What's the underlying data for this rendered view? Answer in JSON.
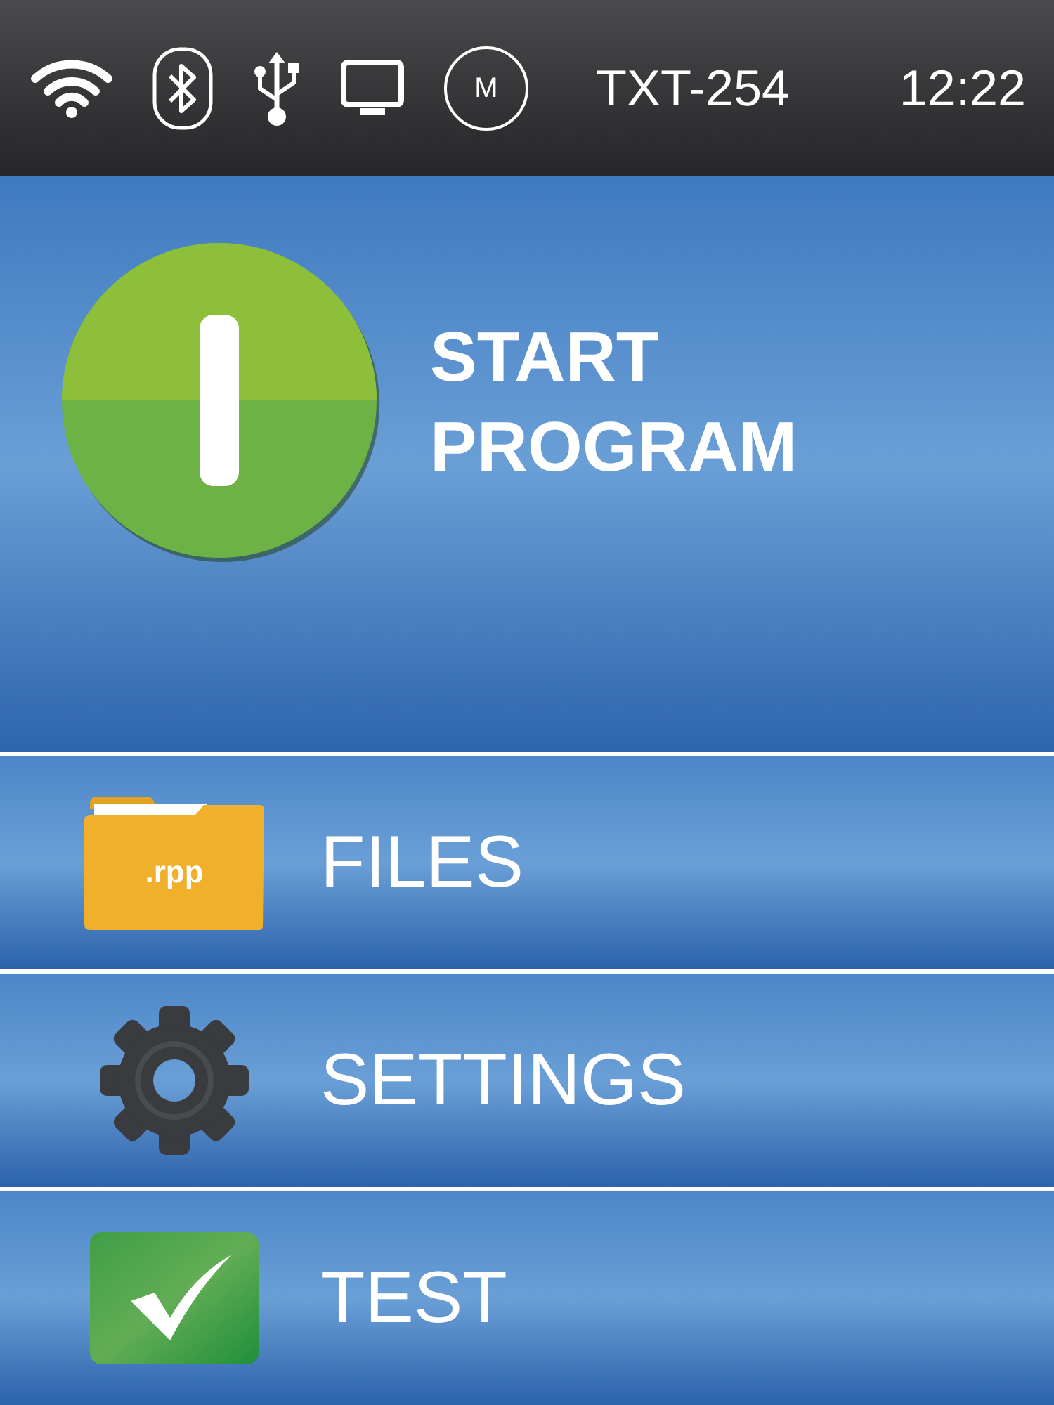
{
  "status_bar": {
    "icons": [
      {
        "kind": "wifi"
      },
      {
        "kind": "bluetooth"
      },
      {
        "kind": "usb"
      },
      {
        "kind": "monitor"
      },
      {
        "kind": "mode",
        "label": "M"
      }
    ],
    "device": "TXT-254",
    "time": "12:22"
  },
  "start": {
    "label": "START PROGRAM"
  },
  "menu": [
    {
      "kind": "folder",
      "label": "FILES",
      "badge": ".rpp"
    },
    {
      "kind": "gear",
      "label": "SETTINGS"
    },
    {
      "kind": "check",
      "label": "TEST"
    }
  ]
}
